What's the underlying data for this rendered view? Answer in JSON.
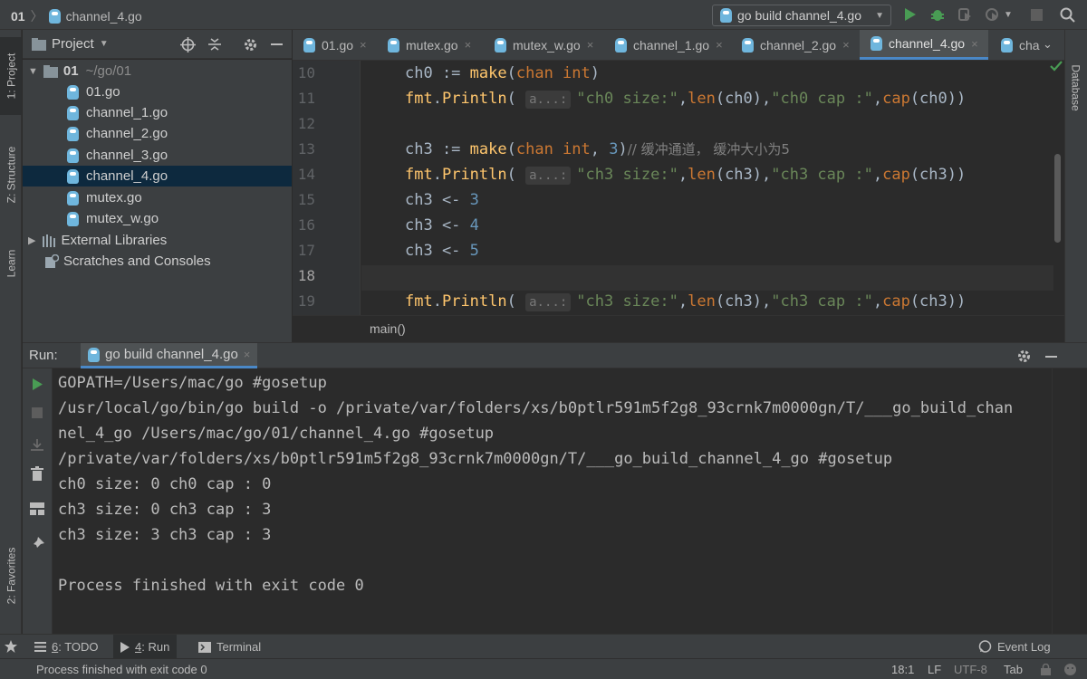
{
  "breadcrumb": {
    "project": "01",
    "file": "channel_4.go"
  },
  "run_config": {
    "label": "go build channel_4.go"
  },
  "left_tools": {
    "project": "1: Project",
    "structure": "Z: Structure",
    "learn": "Learn",
    "favorites": "2: Favorites"
  },
  "right_tools": {
    "database": "Database"
  },
  "project_panel": {
    "title": "Project",
    "root_name": "01",
    "root_path": "~/go/01",
    "files": [
      "01.go",
      "channel_1.go",
      "channel_2.go",
      "channel_3.go",
      "channel_4.go",
      "mutex.go",
      "mutex_w.go"
    ],
    "selected": "channel_4.go",
    "external_libraries": "External Libraries",
    "scratches": "Scratches and Consoles"
  },
  "editor_tabs": [
    {
      "label": "01.go"
    },
    {
      "label": "mutex.go"
    },
    {
      "label": "mutex_w.go"
    },
    {
      "label": "channel_1.go"
    },
    {
      "label": "channel_2.go"
    },
    {
      "label": "channel_4.go",
      "active": true
    },
    {
      "label": "cha"
    }
  ],
  "editor": {
    "line_numbers": [
      "10",
      "11",
      "12",
      "13",
      "14",
      "15",
      "16",
      "17",
      "18",
      "19"
    ],
    "current_line": "18",
    "inlay_hint": "a...:",
    "comment": "// 缓冲通道， 缓冲大小为5",
    "breadcrumb": "main()"
  },
  "run_panel": {
    "label": "Run:",
    "tab": "go build channel_4.go",
    "output": [
      "GOPATH=/Users/mac/go #gosetup",
      "/usr/local/go/bin/go build -o /private/var/folders/xs/b0ptlr591m5f2g8_93crnk7m0000gn/T/___go_build_chan",
      "nel_4_go /Users/mac/go/01/channel_4.go #gosetup",
      "/private/var/folders/xs/b0ptlr591m5f2g8_93crnk7m0000gn/T/___go_build_channel_4_go #gosetup",
      "ch0 size: 0 ch0 cap : 0",
      "ch3 size: 0 ch3 cap : 3",
      "ch3 size: 3 ch3 cap : 3",
      "",
      "Process finished with exit code 0"
    ]
  },
  "bottom_tabs": [
    {
      "num": "6",
      "label": ": TODO"
    },
    {
      "num": "4",
      "label": ": Run",
      "active": true
    },
    {
      "num": "",
      "label": "Terminal"
    }
  ],
  "event_log": "Event Log",
  "status_bar": {
    "message": "Process finished with exit code 0",
    "position": "18:1",
    "line_sep": "LF",
    "encoding": "UTF-8",
    "indent": "Tab"
  },
  "colors": {
    "background": "#2b2b2b",
    "panel": "#3c3f41",
    "accent": "#4a88c7",
    "keyword": "#cc7832",
    "function": "#ffc66d",
    "string": "#6a8759",
    "number": "#6897bb",
    "run_green": "#499c54"
  }
}
